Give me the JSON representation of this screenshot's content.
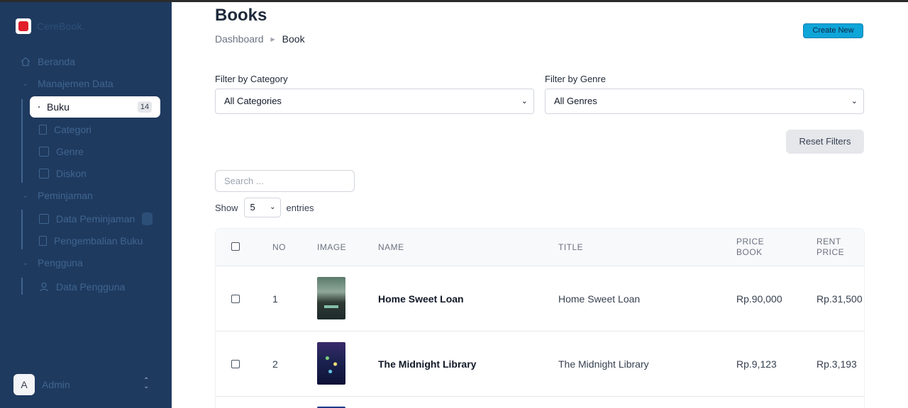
{
  "brand": {
    "name": "CereBook."
  },
  "sidebar": {
    "beranda": "Beranda",
    "manajemen": "Manajemen Data",
    "buku": "Buku",
    "buku_count": "14",
    "categori": "Categori",
    "genre": "Genre",
    "diskon": "Diskon",
    "peminjaman": "Peminjaman",
    "data_peminjaman": "Data Peminjaman",
    "pengembalian": "Pengembalian Buku",
    "pengguna": "Pengguna",
    "data_pengguna": "Data Pengguna"
  },
  "user": {
    "initial": "A",
    "name": "Admin"
  },
  "header": {
    "title": "Books",
    "breadcrumb": [
      "Dashboard",
      "Book"
    ],
    "create_label": "Create New"
  },
  "filters": {
    "category_label": "Filter by Category",
    "category_value": "All Categories",
    "genre_label": "Filter by Genre",
    "genre_value": "All Genres",
    "reset_label": "Reset Filters"
  },
  "search": {
    "placeholder": "Search ..."
  },
  "entries": {
    "show": "Show",
    "value": "5",
    "suffix": "entries"
  },
  "table": {
    "columns": [
      "NO",
      "IMAGE",
      "NAME",
      "TITLE",
      "PRICE BOOK",
      "RENT PRICE"
    ],
    "rows": [
      {
        "no": "1",
        "name": "Home Sweet Loan",
        "title": "Home Sweet Loan",
        "price": "Rp.90,000",
        "rent": "Rp.31,500"
      },
      {
        "no": "2",
        "name": "The Midnight Library",
        "title": "The Midnight Library",
        "price": "Rp.9,123",
        "rent": "Rp.3,193"
      }
    ]
  }
}
